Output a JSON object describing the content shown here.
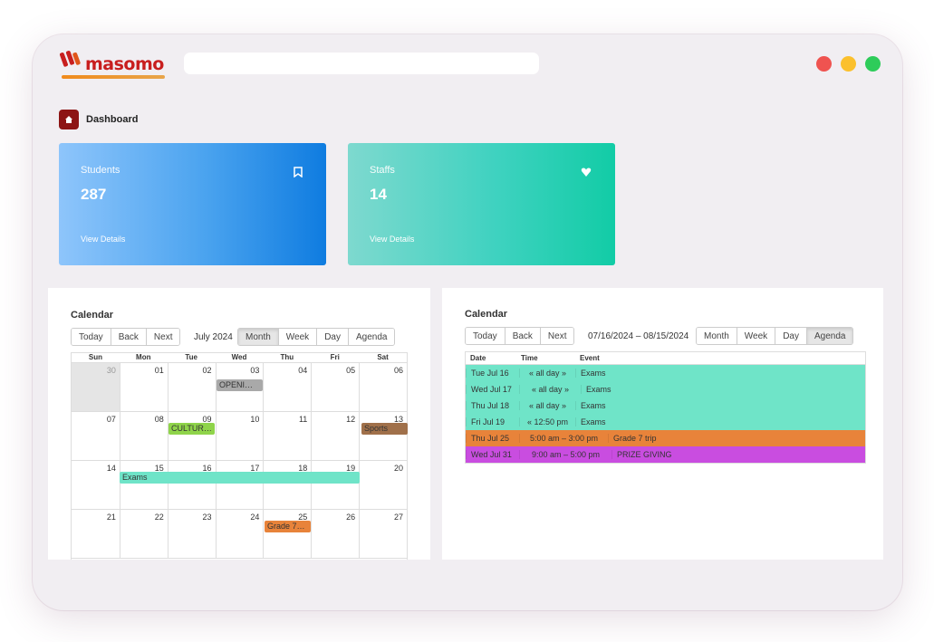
{
  "brand": {
    "name": "masomo"
  },
  "window_controls": [
    {
      "name": "close",
      "color": "#ef5350"
    },
    {
      "name": "minimize",
      "color": "#fbc02d"
    },
    {
      "name": "maximize",
      "color": "#2ecc5a"
    }
  ],
  "breadcrumb": {
    "icon": "home-icon",
    "label": "Dashboard"
  },
  "stats": [
    {
      "label": "Students",
      "value": "287",
      "link": "View Details",
      "icon": "bookmark-icon"
    },
    {
      "label": "Staffs",
      "value": "14",
      "link": "View Details",
      "icon": "heart-icon"
    }
  ],
  "month_calendar": {
    "title": "Calendar",
    "toolbar": [
      "Today",
      "Back",
      "Next"
    ],
    "label": "July 2024",
    "views": [
      "Month",
      "Week",
      "Day",
      "Agenda"
    ],
    "active_view": "Month",
    "weekdays": [
      "Sun",
      "Mon",
      "Tue",
      "Wed",
      "Thu",
      "Fri",
      "Sat"
    ],
    "weeks": [
      [
        "30",
        "01",
        "02",
        "03",
        "04",
        "05",
        "06"
      ],
      [
        "07",
        "08",
        "09",
        "10",
        "11",
        "12",
        "13"
      ],
      [
        "14",
        "15",
        "16",
        "17",
        "18",
        "19",
        "20"
      ],
      [
        "21",
        "22",
        "23",
        "24",
        "25",
        "26",
        "27"
      ]
    ],
    "events": [
      {
        "title": "OPENI…",
        "color": "#a9a9a9"
      },
      {
        "title": "CULTUR…",
        "color": "#8fd44a"
      },
      {
        "title": "Sports",
        "color": "#a0704a"
      },
      {
        "title": "Exams",
        "color": "#6fe4c8"
      },
      {
        "title": "Grade 7…",
        "color": "#e8833a"
      }
    ]
  },
  "agenda_calendar": {
    "title": "Calendar",
    "toolbar": [
      "Today",
      "Back",
      "Next"
    ],
    "label": "07/16/2024 – 08/15/2024",
    "views": [
      "Month",
      "Week",
      "Day",
      "Agenda"
    ],
    "active_view": "Agenda",
    "columns": [
      "Date",
      "Time",
      "Event"
    ],
    "rows": [
      {
        "date": "Tue Jul 16",
        "time": "« all day »",
        "event": "Exams",
        "color": "#6fe4c8"
      },
      {
        "date": "Wed Jul 17",
        "time": "« all day »",
        "event": "Exams",
        "color": "#6fe4c8"
      },
      {
        "date": "Thu Jul 18",
        "time": "« all day »",
        "event": "Exams",
        "color": "#6fe4c8"
      },
      {
        "date": "Fri Jul 19",
        "time": "« 12:50 pm",
        "event": "Exams",
        "color": "#6fe4c8"
      },
      {
        "date": "Thu Jul 25",
        "time": "5:00 am – 3:00 pm",
        "event": "Grade 7 trip",
        "color": "#e8833a"
      },
      {
        "date": "Wed Jul 31",
        "time": "9:00 am – 5:00 pm",
        "event": "PRIZE GIVING",
        "color": "#c94de0"
      }
    ]
  }
}
